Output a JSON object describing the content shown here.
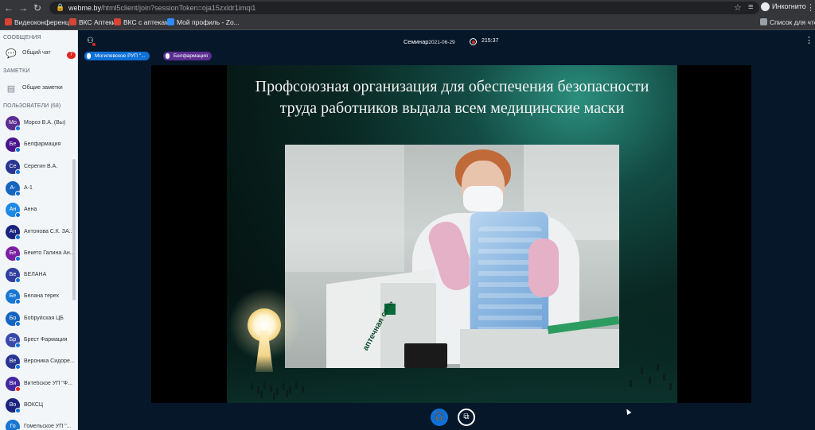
{
  "browser": {
    "url_host": "webme.by",
    "url_path": "/html5client/join?sessionToken=oja15zxldr1imqi1",
    "profile_label": "Инкогнито",
    "reading_list": "Список для чтения"
  },
  "bookmarks": [
    {
      "label": "Видеоконференц...",
      "color": "#d64436"
    },
    {
      "label": "ВКС Аптеки",
      "color": "#d64436"
    },
    {
      "label": "ВКС с аптеками",
      "color": "#d64436"
    },
    {
      "label": "Мой профиль - Zo...",
      "color": "#2d8cff"
    }
  ],
  "sidebar": {
    "messages_heading": "СООБЩЕНИЯ",
    "public_chat": "Общий чат",
    "chat_badge": "7",
    "notes_heading": "ЗАМЕТКИ",
    "shared_notes": "Общие заметки",
    "users_heading": "ПОЛЬЗОВАТЕЛИ (68)",
    "users": [
      {
        "initials": "Мо",
        "name": "Мороз В.А. (Вы)",
        "color": "#5b2e91",
        "muted": false
      },
      {
        "initials": "Бе",
        "name": "Белфармация",
        "color": "#4a148c",
        "muted": false
      },
      {
        "initials": "Се",
        "name": "Серегин В.А.",
        "color": "#283593",
        "muted": false
      },
      {
        "initials": "А-",
        "name": "А-1",
        "color": "#1565c0",
        "muted": false
      },
      {
        "initials": "Ан",
        "name": "Анна",
        "color": "#1e88e5",
        "muted": false
      },
      {
        "initials": "Ан",
        "name": "Антонова С.К. ЗА...",
        "color": "#1a237e",
        "muted": false
      },
      {
        "initials": "Бе",
        "name": "Бекето Галина Ан...",
        "color": "#7b1fa2",
        "muted": false
      },
      {
        "initials": "Бе",
        "name": "БЕЛАНА",
        "color": "#303f9f",
        "muted": false
      },
      {
        "initials": "Бе",
        "name": "Белана терех",
        "color": "#1976d2",
        "muted": false
      },
      {
        "initials": "Бо",
        "name": "Бобруйская ЦБ",
        "color": "#1565c0",
        "muted": false
      },
      {
        "initials": "Бр",
        "name": "Брест Фармация",
        "color": "#3949ab",
        "muted": false
      },
      {
        "initials": "Ве",
        "name": "Вероника Сидоре...",
        "color": "#283593",
        "muted": false
      },
      {
        "initials": "Ви",
        "name": "Витебское УП \"Ф...",
        "color": "#4527a0",
        "muted": true
      },
      {
        "initials": "Во",
        "name": "ВОКСЦ",
        "color": "#1a237e",
        "muted": false
      },
      {
        "initials": "Го",
        "name": "Гомельское УП \"...",
        "color": "#1976d2",
        "muted": false
      }
    ]
  },
  "meeting": {
    "title": "Семинар",
    "date": "2021-06-29",
    "timer": "215:37"
  },
  "talkers": [
    {
      "label": "Могилевское РУП \"...",
      "color": "#0f70d7"
    },
    {
      "label": "Белфармация",
      "color": "#5b2e91"
    }
  ],
  "slide": {
    "title": "Профсоюзная организация для обеспечения безопасности труда работников выдала всем медицинские маски",
    "box_text": "аптечная сеть"
  },
  "controls": {
    "audio_icon": "headphones-icon",
    "video_icon": "screenshare-icon"
  },
  "colors": {
    "accent": "#0f70d7",
    "danger": "#df2721",
    "sidebar_bg": "#f3f6f9",
    "main_bg": "#06172a"
  }
}
